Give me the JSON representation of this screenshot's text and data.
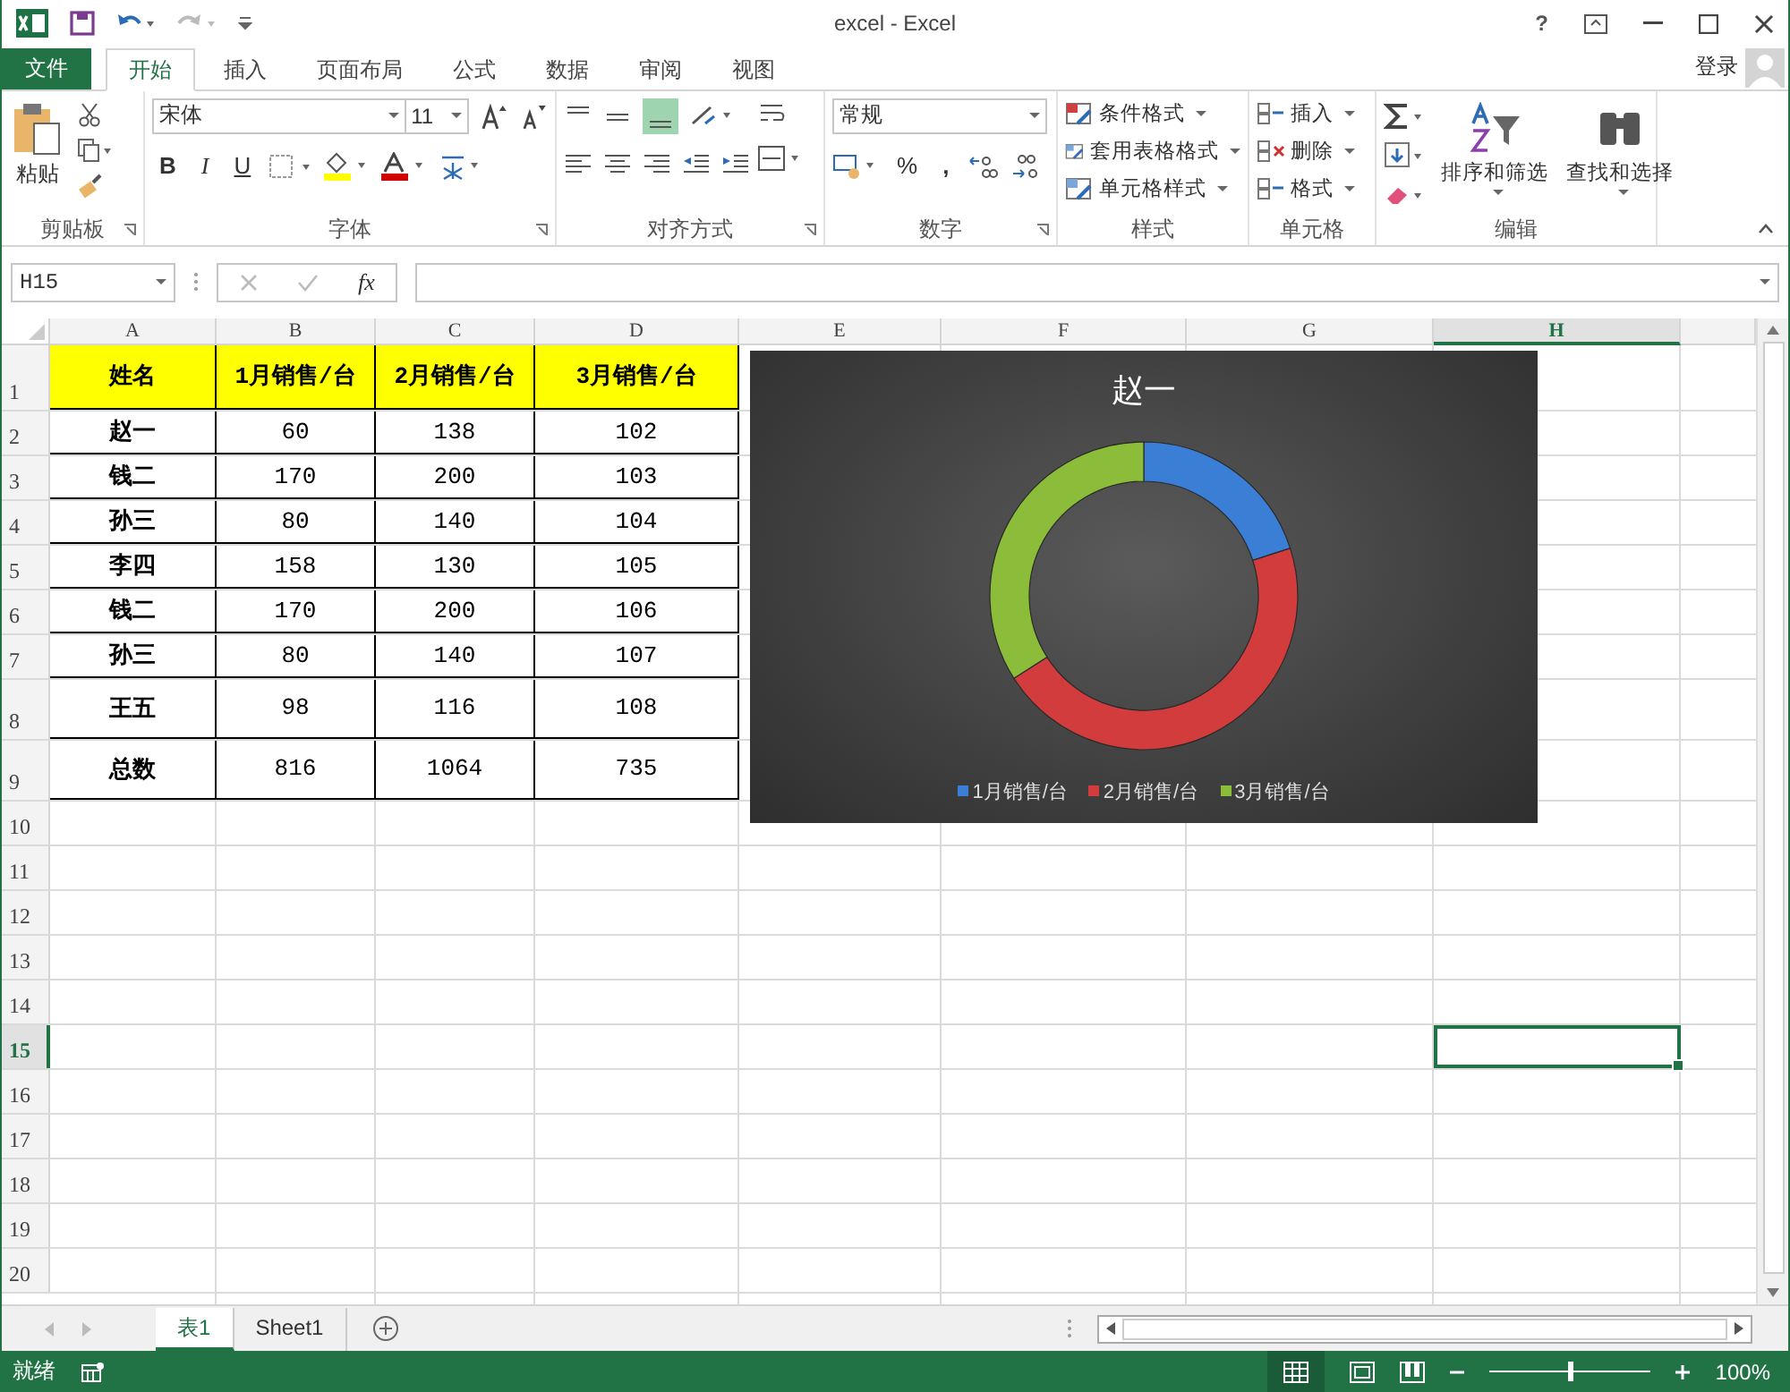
{
  "window": {
    "title": "excel - Excel",
    "help": "?",
    "signin": "登录"
  },
  "ribbon_tabs": [
    {
      "label": "文件",
      "kind": "file",
      "selected": false
    },
    {
      "label": "开始",
      "kind": "tab",
      "selected": true
    },
    {
      "label": "插入",
      "kind": "tab",
      "selected": false
    },
    {
      "label": "页面布局",
      "kind": "tab",
      "selected": false
    },
    {
      "label": "公式",
      "kind": "tab",
      "selected": false
    },
    {
      "label": "数据",
      "kind": "tab",
      "selected": false
    },
    {
      "label": "审阅",
      "kind": "tab",
      "selected": false
    },
    {
      "label": "视图",
      "kind": "tab",
      "selected": false
    }
  ],
  "ribbon": {
    "clipboard": {
      "label": "剪贴板",
      "paste": "粘贴"
    },
    "font": {
      "label": "字体",
      "font_name": "宋体",
      "font_size": "11",
      "bold": "B",
      "italic": "I",
      "underline": "U"
    },
    "alignment": {
      "label": "对齐方式"
    },
    "number": {
      "label": "数字",
      "format": "常规",
      "percent": "%",
      "comma": ","
    },
    "styles": {
      "label": "样式",
      "items": [
        "条件格式",
        "套用表格格式",
        "单元格样式"
      ]
    },
    "cells": {
      "label": "单元格",
      "items": [
        "插入",
        "删除",
        "格式"
      ]
    },
    "editing": {
      "label": "编辑",
      "sort": "排序和筛选",
      "find": "查找和选择"
    }
  },
  "formula_bar": {
    "name_box": "H15",
    "fx": "fx"
  },
  "columns": [
    {
      "label": "A",
      "selected": false
    },
    {
      "label": "B",
      "selected": false
    },
    {
      "label": "C",
      "selected": false
    },
    {
      "label": "D",
      "selected": false
    },
    {
      "label": "E",
      "selected": false
    },
    {
      "label": "F",
      "selected": false
    },
    {
      "label": "G",
      "selected": false
    },
    {
      "label": "H",
      "selected": true
    }
  ],
  "rows": [
    {
      "number": "1",
      "kind": "header",
      "selected": false,
      "cells": [
        "姓名",
        "1月销售/台",
        "2月销售/台",
        "3月销售/台"
      ]
    },
    {
      "number": "2",
      "kind": "data",
      "selected": false,
      "cells": [
        "赵一",
        "60",
        "138",
        "102"
      ]
    },
    {
      "number": "3",
      "kind": "data",
      "selected": false,
      "cells": [
        "钱二",
        "170",
        "200",
        "103"
      ]
    },
    {
      "number": "4",
      "kind": "data",
      "selected": false,
      "cells": [
        "孙三",
        "80",
        "140",
        "104"
      ]
    },
    {
      "number": "5",
      "kind": "data",
      "selected": false,
      "cells": [
        "李四",
        "158",
        "130",
        "105"
      ]
    },
    {
      "number": "6",
      "kind": "data",
      "selected": false,
      "cells": [
        "钱二",
        "170",
        "200",
        "106"
      ]
    },
    {
      "number": "7",
      "kind": "data",
      "selected": false,
      "cells": [
        "孙三",
        "80",
        "140",
        "107"
      ]
    },
    {
      "number": "8",
      "kind": "tall",
      "selected": false,
      "cells": [
        "王五",
        "98",
        "116",
        "108"
      ]
    },
    {
      "number": "9",
      "kind": "tall",
      "selected": false,
      "cells": [
        "总数",
        "816",
        "1064",
        "735"
      ]
    },
    {
      "number": "10",
      "kind": "blank",
      "selected": false
    },
    {
      "number": "11",
      "kind": "blank",
      "selected": false
    },
    {
      "number": "12",
      "kind": "blank",
      "selected": false
    },
    {
      "number": "13",
      "kind": "blank",
      "selected": false
    },
    {
      "number": "14",
      "kind": "blank",
      "selected": false
    },
    {
      "number": "15",
      "kind": "blank",
      "selected": true
    },
    {
      "number": "16",
      "kind": "blank",
      "selected": false
    },
    {
      "number": "17",
      "kind": "blank",
      "selected": false
    },
    {
      "number": "18",
      "kind": "blank",
      "selected": false
    },
    {
      "number": "19",
      "kind": "blank",
      "selected": false
    },
    {
      "number": "20",
      "kind": "blank",
      "selected": false
    }
  ],
  "chart": {
    "chart_data": {
      "type": "donut",
      "title": "赵一",
      "categories": [
        "1月销售/台",
        "2月销售/台",
        "3月销售/台"
      ],
      "values": [
        20,
        46,
        34
      ],
      "colors": [
        "#3a7fd5",
        "#d23c3c",
        "#8bbd3a"
      ],
      "legend": "bottom"
    }
  },
  "sheet_tabs": [
    {
      "label": "表1",
      "selected": true
    },
    {
      "label": "Sheet1",
      "selected": false
    }
  ],
  "status_bar": {
    "status": "就绪",
    "zoom": "100%",
    "zoom_slider": {
      "level": 0.5
    }
  }
}
